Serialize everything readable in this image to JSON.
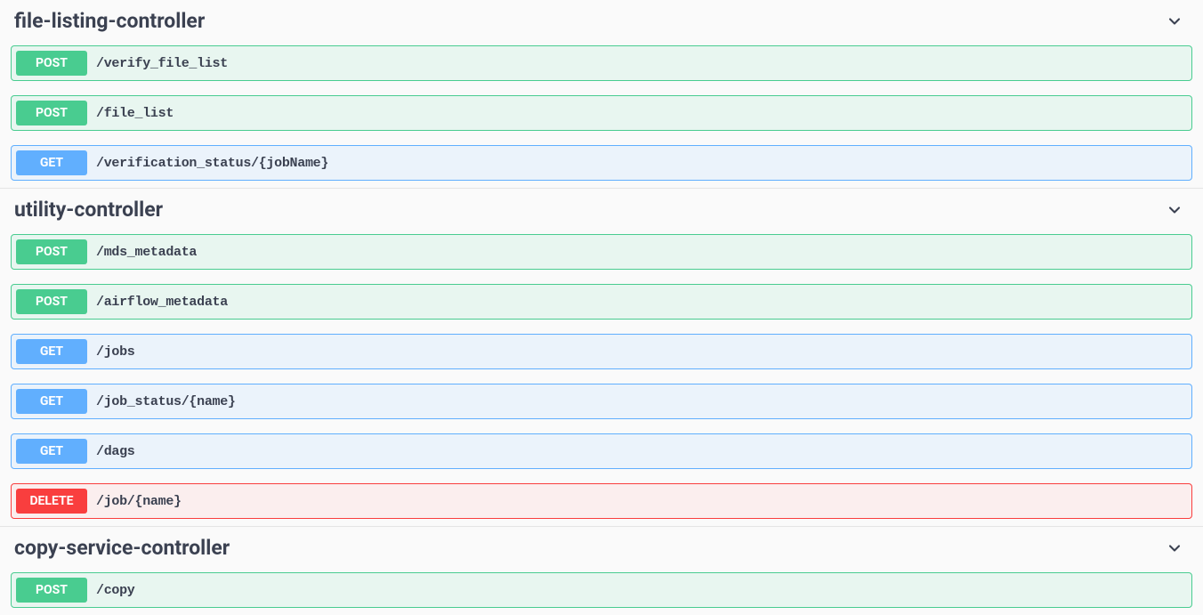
{
  "methods": {
    "post": "POST",
    "get": "GET",
    "delete": "DELETE"
  },
  "controllers": [
    {
      "name": "file-listing-controller",
      "endpoints": [
        {
          "method": "post",
          "path": "/verify_file_list"
        },
        {
          "method": "post",
          "path": "/file_list"
        },
        {
          "method": "get",
          "path": "/verification_status/{jobName}"
        }
      ]
    },
    {
      "name": "utility-controller",
      "endpoints": [
        {
          "method": "post",
          "path": "/mds_metadata"
        },
        {
          "method": "post",
          "path": "/airflow_metadata"
        },
        {
          "method": "get",
          "path": "/jobs"
        },
        {
          "method": "get",
          "path": "/job_status/{name}"
        },
        {
          "method": "get",
          "path": "/dags"
        },
        {
          "method": "delete",
          "path": "/job/{name}"
        }
      ]
    },
    {
      "name": "copy-service-controller",
      "endpoints": [
        {
          "method": "post",
          "path": "/copy"
        }
      ]
    }
  ]
}
